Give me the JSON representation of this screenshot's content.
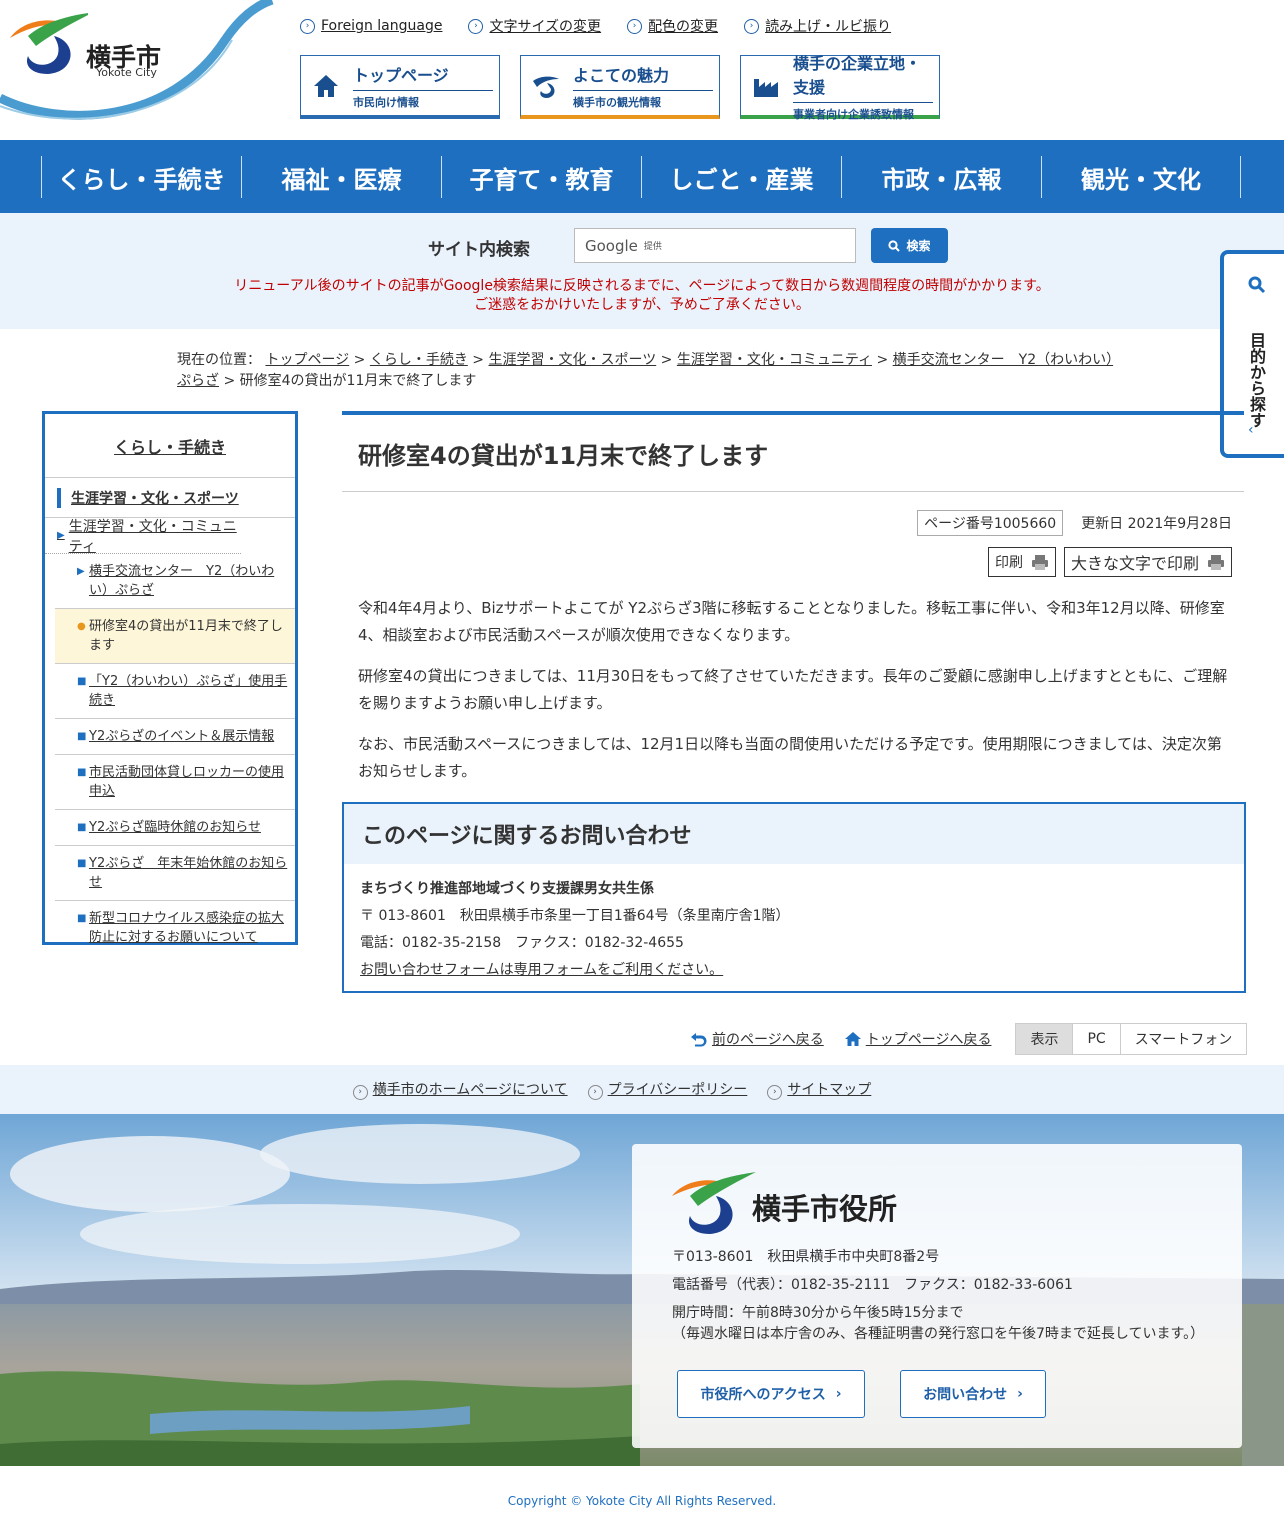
{
  "header": {
    "logo_text": "横手市",
    "logo_sub": "Yokote City",
    "top_links": [
      "Foreign language",
      "文字サイズの変更",
      "配色の変更",
      "読み上げ・ルビ振り"
    ],
    "banners": [
      {
        "title": "トップページ",
        "sub": "市民向け情報",
        "icon": "house-icon"
      },
      {
        "title": "よこての魅力",
        "sub": "横手市の観光情報",
        "icon": "bird-icon"
      },
      {
        "title": "横手の企業立地・支援",
        "sub": "事業者向け企業誘致情報",
        "icon": "factory-icon"
      }
    ]
  },
  "global_nav": [
    "くらし・手続き",
    "福祉・医療",
    "子育て・教育",
    "しごと・産業",
    "市政・広報",
    "観光・文化"
  ],
  "search": {
    "label": "サイト内検索",
    "google": "Google",
    "provided": "提供",
    "button": "検索",
    "note_line1": "リニューアル後のサイトの記事がGoogle検索結果に反映されるまでに、ページによって数日から数週間程度の時間がかかります。",
    "note_line2": "ご迷惑をおかけいたしますが、予めご了承ください。"
  },
  "side_tab": {
    "label": "目的から探す"
  },
  "breadcrumb": {
    "prefix": "現在の位置：",
    "items": [
      "トップページ",
      "くらし・手続き",
      "生涯学習・文化・スポーツ",
      "生涯学習・文化・コミュニティ",
      "横手交流センター　Y2（わいわい）ぷらざ"
    ],
    "current": "研修室4の貸出が11月末で終了します"
  },
  "sidebar": {
    "heading": "くらし・手続き",
    "level1": "生涯学習・文化・スポーツ",
    "level2": "生涯学習・文化・コミュニティ",
    "items": [
      "横手交流センター　Y2（わいわい）ぷらざ",
      "研修室4の貸出が11月末で終了します",
      "「Y2（わいわい）ぷらざ」使用手続き",
      "Y2ぷらざのイベント＆展示情報",
      "市民活動団体貸しロッカーの使用申込",
      "Y2ぷらざ臨時休館のお知らせ",
      "Y2ぷらざ　年末年始休館のお知らせ",
      "新型コロナウイルス感染症の拡大防止に対するお願いについて"
    ]
  },
  "article": {
    "title": "研修室4の貸出が11月末で終了します",
    "page_number": "ページ番号1005660",
    "updated": "更新日 2021年9月28日",
    "print": "印刷",
    "print_large": "大きな文字で印刷",
    "paragraphs": [
      "令和4年4月より、Bizサポートよこてが Y2ぷらざ3階に移転することとなりました。移転工事に伴い、令和3年12月以降、研修室4、相談室および市民活動スペースが順次使用できなくなります。",
      "研修室4の貸出につきましては、11月30日をもって終了させていただきます。長年のご愛顧に感謝申し上げますとともに、ご理解を賜りますようお願い申し上げます。",
      "なお、市民活動スペースにつきましては、12月1日以降も当面の間使用いただける予定です。使用期限につきましては、決定次第お知らせします。"
    ]
  },
  "contact": {
    "heading": "このページに関するお問い合わせ",
    "dept": "まちづくり推進部地域づくり支援課男女共生係",
    "address": "〒 013-8601　秋田県横手市条里一丁目1番64号（条里南庁舎1階）",
    "phone": "電話：0182-35-2158　ファクス：0182-32-4655",
    "form": "お問い合わせフォームは専用フォームをご利用ください。"
  },
  "page_nav": {
    "back": "前のページへ戻る",
    "top": "トップページへ戻る",
    "view_label": "表示",
    "pc": "PC",
    "sp": "スマートフォン"
  },
  "footer_links": [
    "横手市のホームページについて",
    "プライバシーポリシー",
    "サイトマップ"
  ],
  "footer_card": {
    "name": "横手市役所",
    "address": "〒013-8601　秋田県横手市中央町8番2号",
    "phone": "電話番号（代表）：0182-35-2111　ファクス：0182-33-6061",
    "hours1": "開庁時間：午前8時30分から午後5時15分まで",
    "hours2": "（毎週水曜日は本庁舎のみ、各種証明書の発行窓口を午後7時まで延長しています。）",
    "access_btn": "市役所へのアクセス",
    "contact_btn": "お問い合わせ"
  },
  "copyright": "Copyright © Yokote City All Rights Reserved.",
  "colors": {
    "primary": "#1e6fc0",
    "alert": "#c00000",
    "orange": "#e8961c",
    "green": "#3aa34a"
  }
}
